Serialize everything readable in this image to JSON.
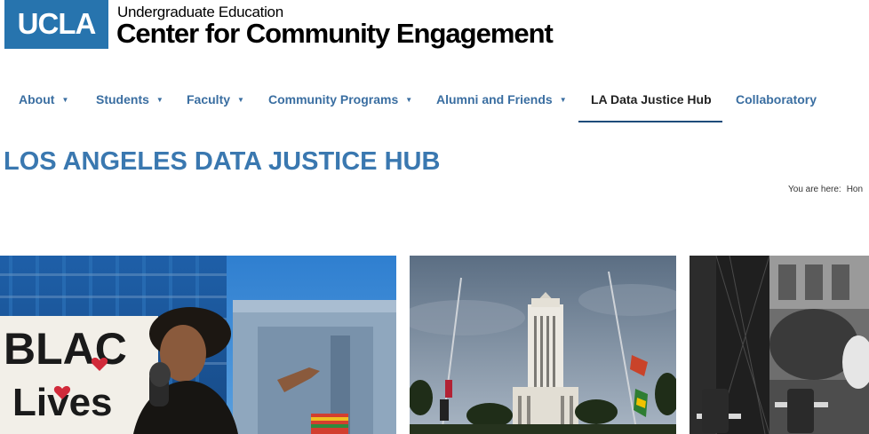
{
  "header": {
    "logo_text": "UCLA",
    "subtitle": "Undergraduate Education",
    "title": "Center for Community Engagement"
  },
  "nav": {
    "items": [
      {
        "label": "About",
        "has_dropdown": true
      },
      {
        "label": "Students",
        "has_dropdown": true
      },
      {
        "label": "Faculty",
        "has_dropdown": true
      },
      {
        "label": "Community Programs",
        "has_dropdown": true
      },
      {
        "label": "Alumni and Friends",
        "has_dropdown": true
      },
      {
        "label": "LA Data Justice Hub",
        "has_dropdown": false,
        "active": true
      },
      {
        "label": "Collaboratory",
        "has_dropdown": false
      }
    ],
    "caret": "▼"
  },
  "page": {
    "title": "LOS ANGELES DATA JUSTICE HUB"
  },
  "breadcrumb": {
    "prefix": "You are here:",
    "home": "Hon"
  },
  "photos": [
    {
      "sign_text": [
        "BLAC",
        "Lives"
      ]
    }
  ],
  "colors": {
    "ucla_blue": "#2774ae",
    "nav_link": "#3a6ea1",
    "title_blue": "#3a78b0"
  }
}
